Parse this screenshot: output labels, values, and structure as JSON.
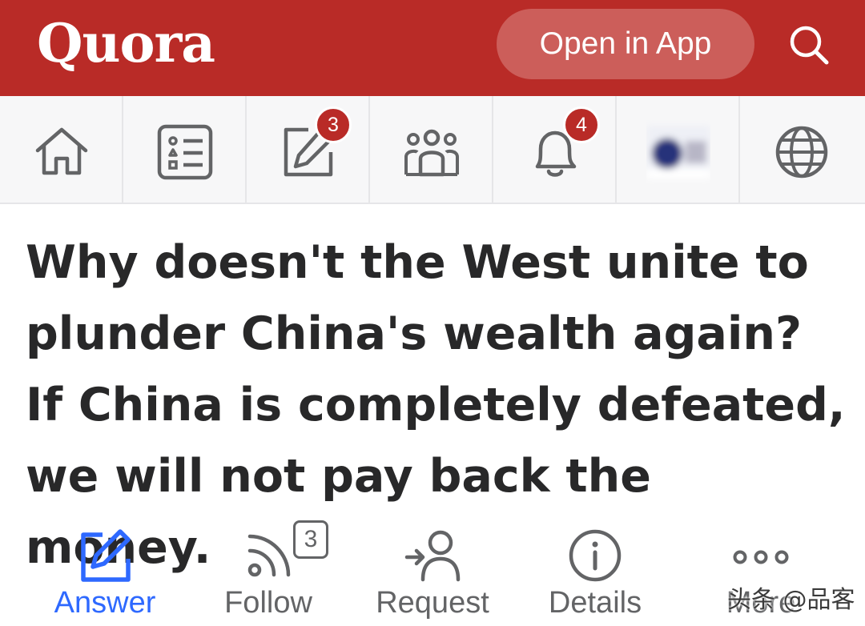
{
  "header": {
    "logo": "Quora",
    "open_app_label": "Open in App",
    "search_icon": "search-icon",
    "background_color": "#b92b27"
  },
  "nav": {
    "items": [
      {
        "icon": "home-icon"
      },
      {
        "icon": "following-feed-icon"
      },
      {
        "icon": "write-answer-icon",
        "badge": "3"
      },
      {
        "icon": "spaces-icon"
      },
      {
        "icon": "bell-icon",
        "badge": "4"
      },
      {
        "icon": "profile-avatar"
      },
      {
        "icon": "globe-icon"
      }
    ],
    "badge_color": "#b92b27"
  },
  "question": {
    "title": "Why doesn't the West unite to plunder China's wealth again? If China is completely defeated, we will not pay back the money."
  },
  "actions": {
    "answer": {
      "label": "Answer",
      "icon": "pencil-square-icon",
      "color": "#2e69ff"
    },
    "follow": {
      "label": "Follow",
      "icon": "rss-feed-icon",
      "count": "3"
    },
    "request": {
      "label": "Request",
      "icon": "request-user-icon"
    },
    "details": {
      "label": "Details",
      "icon": "info-icon"
    },
    "more": {
      "label": "More",
      "icon": "more-dots-icon"
    }
  },
  "watermark": "头条 @品客"
}
